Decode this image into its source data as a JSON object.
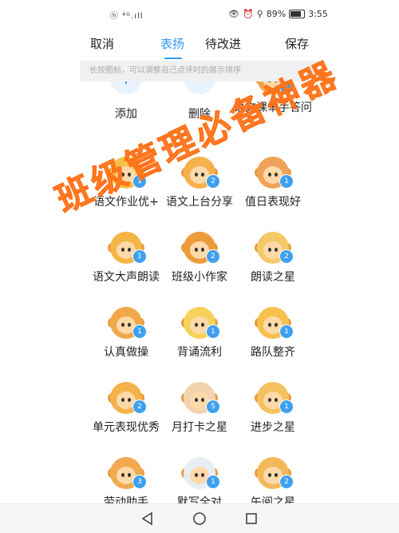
{
  "status": {
    "left": "ⓗ ⁴ᴳ.ıll",
    "battery": "89%",
    "time": "3:55"
  },
  "nav": {
    "cancel": "取消",
    "praise": "表扬",
    "to_improve": "待改进",
    "save": "保存"
  },
  "hint": "长按图标，可以调整自己点评时的展示排序",
  "actions": {
    "add": "添加",
    "add_symbol": "+",
    "delete": "删除",
    "delete_symbol": "−"
  },
  "items": [
    {
      "label": "语文课举手答问",
      "count": "1"
    },
    {
      "label": "语文作业优+",
      "count": "1"
    },
    {
      "label": "语文上台分享",
      "count": "2"
    },
    {
      "label": "值日表现好",
      "count": "1"
    },
    {
      "label": "语文大声朗读",
      "count": "1"
    },
    {
      "label": "班级小作家",
      "count": "2"
    },
    {
      "label": "朗读之星",
      "count": "2"
    },
    {
      "label": "认真做操",
      "count": "1"
    },
    {
      "label": "背诵流利",
      "count": "1"
    },
    {
      "label": "路队整齐",
      "count": "1"
    },
    {
      "label": "单元表现优秀",
      "count": "2"
    },
    {
      "label": "月打卡之星",
      "count": "5"
    },
    {
      "label": "进步之星",
      "count": "1"
    },
    {
      "label": "劳动助手",
      "count": "3"
    },
    {
      "label": "默写全对",
      "count": "1"
    },
    {
      "label": "午阅之星",
      "count": "2"
    }
  ],
  "watermark": "班级管理必备神器",
  "colors": {
    "accent": "#2f9bf0",
    "badge": "#3fa0ef",
    "watermark": "#ff781e"
  },
  "icons": {
    "back": "back-triangle-icon",
    "home": "home-circle-icon",
    "recents": "recents-square-icon"
  }
}
